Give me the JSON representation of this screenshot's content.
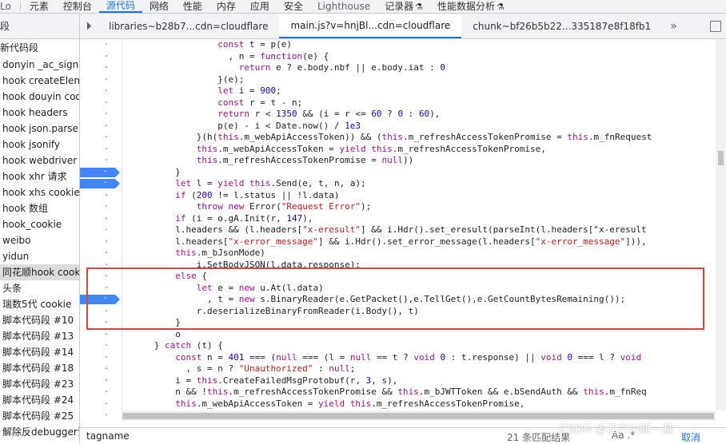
{
  "topbar": {
    "partial_left": "Lo",
    "tabs": [
      "元素",
      "控制台",
      "源代码",
      "网络",
      "性能",
      "内存",
      "应用",
      "安全",
      "Lighthouse",
      "记录器",
      "性能数据分析"
    ],
    "active_tab": "源代码"
  },
  "sidebar": {
    "header": "段",
    "new_snippet": "新代码段",
    "items": [
      "donyin _ac_signature",
      "hook createElement",
      "hook douyin cookie",
      "hook headers",
      "hook json.parse",
      "hook jsonify",
      "hook webdriver",
      "hook xhr 请求",
      "hook xhs cookie",
      "hook 数组",
      "hook_cookie",
      "weibo",
      "yidun",
      "同花顺hook cookie",
      "头条",
      "瑞数5代 cookie",
      "脚本代码段 #10",
      "脚本代码段 #13",
      "脚本代码段 #14",
      "脚本代码段 #18",
      "脚本代码段 #23",
      "脚本代码段 #24",
      "脚本代码段 #25",
      "解除反debugger调"
    ],
    "selected_index": 13
  },
  "filetabs": {
    "tabs": [
      "libraries~b28b7...cdn=cloudflare",
      "main.js?v=hnjBl...cdn=cloudflare",
      "chunk~bf26b5b22...335187e8f18fb1"
    ],
    "active_index": 1
  },
  "gutter": {
    "dash": "-",
    "breakpoint_lines": [
      11,
      12,
      22
    ]
  },
  "code_lines": [
    "                  const t = p(e)",
    "                    , n = function(e) {",
    "                      return e ? e.body.nbf || e.body.iat : 0",
    "                  }(e);",
    "                  let i = 900;",
    "                  const r = t - n;",
    "                  return r < 1350 && (i = r <= 60 ? 0 : 60),",
    "                  p(e) - i < Date.now() / 1e3",
    "              }(h(this.m_webApiAccessToken)) && (this.m_refreshAccessTokenPromise = this.m_fnRequest",
    "              this.m_webApiAccessToken = yield this.m_refreshAccessTokenPromise,",
    "              this.m_refreshAccessTokenPromise = null))",
    "          }",
    "          let l = yield this.Send(e, t, n, a);",
    "          if (200 != l.status || !l.data)",
    "              throw new Error(\"Request Error\");",
    "          if (i = o.gA.Init(r, 147),",
    "          l.headers && (l.headers[\"x-eresult\"] && i.Hdr().set_eresult(parseInt(l.headers[\"x-eresult",
    "          l.headers[\"x-error_message\"] && i.Hdr().set_error_message(l.headers[\"x-error_message\"])),",
    "          this.m_bJsonMode)",
    "              i.SetBodyJSON(l.data.response);",
    "          else {",
    "              let e = new u.At(l.data)",
    "                , t = new s.BinaryReader(e.GetPacket(),e.TellGet(),e.GetCountBytesRemaining());",
    "              r.deserializeBinaryFromReader(i.Body(), t)",
    "          }",
    "          o",
    "      } catch (t) {",
    "          const n = 401 === (null === (l = null == t ? void 0 : t.response) || void 0 === l ? void",
    "            , s = n ? \"Unauthorized\" : null;",
    "          i = this.CreateFailedMsgProtobuf(r, 3, s),",
    "          n && !this.m_refreshAccessTokenPromise && this.m_bJWTToken && e.bSendAuth && this.m_fnReq",
    "          this.m_webApiAccessToken = yield this.m_refreshAccessTokenPromise,",
    "          this.m_refreshAccessTokenPromise = null)"
  ],
  "search": {
    "query": "tagname",
    "result_count": "21 条匹配结果",
    "match_case": "Aa",
    "regex": ".*",
    "cancel": "取消"
  },
  "watermark": "CSDN @江户川新一基",
  "colors": {
    "accent": "#1a73e8",
    "breakpoint": "#4285f4",
    "highlight_box": "#e8413b",
    "keyword": "#aa0d91",
    "string": "#c41a16",
    "number": "#1c00cf"
  }
}
